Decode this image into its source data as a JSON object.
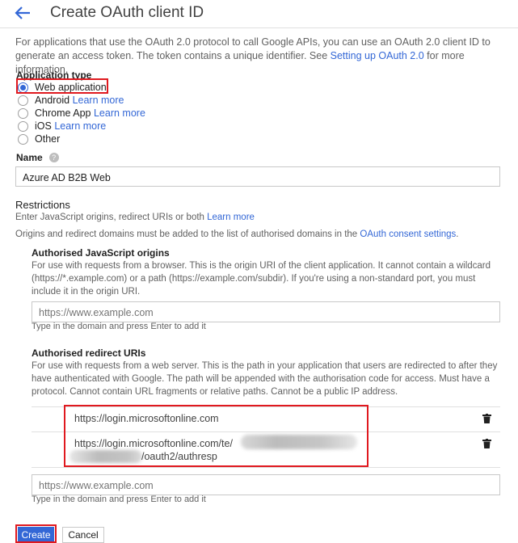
{
  "header": {
    "title": "Create OAuth client ID",
    "back_icon": "arrow-left-icon"
  },
  "intro": {
    "text": "For applications that use the OAuth 2.0 protocol to call Google APIs, you can use an OAuth 2.0 client ID to generate an access token. The token contains a unique identifier. See ",
    "link": "Setting up OAuth 2.0",
    "text_after": " for more information."
  },
  "application_type": {
    "label": "Application type",
    "options": [
      {
        "label": "Web application",
        "selected": true,
        "link": ""
      },
      {
        "label": "Android",
        "selected": false,
        "link": "Learn more"
      },
      {
        "label": "Chrome App",
        "selected": false,
        "link": "Learn more"
      },
      {
        "label": "iOS",
        "selected": false,
        "link": "Learn more"
      },
      {
        "label": "Other",
        "selected": false,
        "link": ""
      }
    ]
  },
  "name": {
    "label": "Name",
    "value": "Azure AD B2B Web",
    "help_icon": "help-icon"
  },
  "restrictions": {
    "title": "Restrictions",
    "desc1": "Enter JavaScript origins, redirect URIs or both ",
    "desc1_link": "Learn more",
    "desc2": "Origins and redirect domains must be added to the list of authorised domains in the ",
    "desc2_link": "OAuth consent settings",
    "desc2_end": "."
  },
  "js_origins": {
    "title": "Authorised JavaScript origins",
    "desc": "For use with requests from a browser. This is the origin URI of the client application. It cannot contain a wildcard (https://*.example.com) or a path (https://example.com/subdir). If you're using a non-standard port, you must include it in the origin URI.",
    "placeholder": "https://www.example.com",
    "hint": "Type in the domain and press Enter to add it"
  },
  "redirect_uris": {
    "title": "Authorised redirect URIs",
    "desc": "For use with requests from a web server. This is the path in your application that users are redirected to after they have authenticated with Google. The path will be appended with the authorisation code for access. Must have a protocol. Cannot contain URL fragments or relative paths. Cannot be a public IP address.",
    "uris": [
      "https://login.microsoftonline.com",
      "https://login.microsoftonline.com/te/",
      "/oauth2/authresp"
    ],
    "delete_icon": "trash-icon",
    "placeholder": "https://www.example.com",
    "hint": "Type in the domain and press Enter to add it"
  },
  "buttons": {
    "create": "Create",
    "cancel": "Cancel"
  },
  "colors": {
    "accent": "#3367d6",
    "highlight": "#e0191f"
  }
}
